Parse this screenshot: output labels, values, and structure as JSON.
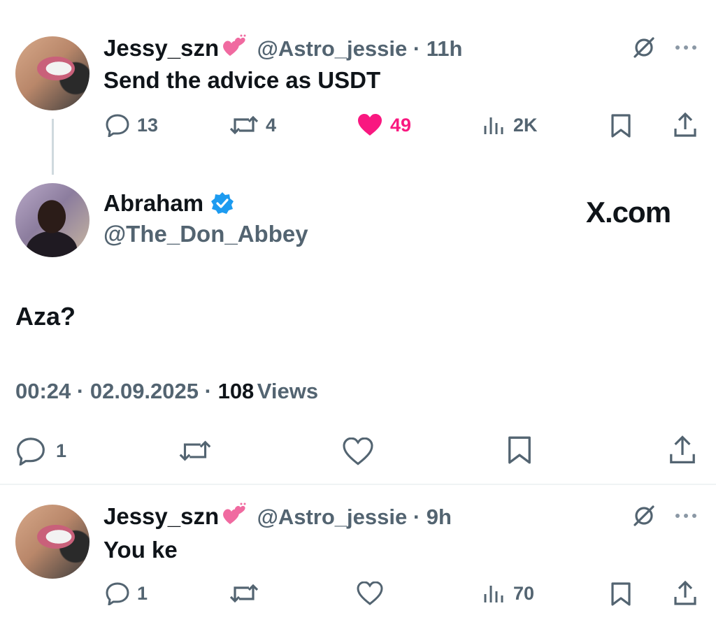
{
  "tweet1": {
    "name": "Jessy_szn",
    "handle": "@Astro_jessie",
    "time": "11h",
    "text": "Send the advice as USDT",
    "replies": "13",
    "reposts": "4",
    "likes": "49",
    "views": "2K",
    "liked": true
  },
  "main": {
    "name": "Abraham",
    "handle": "@The_Don_Abbey",
    "verified": true,
    "watermark": "X.com",
    "text": "Aza?",
    "time": "00:24",
    "date": "02.09.2025",
    "views_count": "108",
    "views_label": "Views",
    "replies": "1"
  },
  "tweet2": {
    "name": "Jessy_szn",
    "handle": "@Astro_jessie",
    "time": "9h",
    "text": "You ke",
    "replies": "1",
    "views": "70"
  },
  "colors": {
    "text": "#0f1419",
    "muted": "#536471",
    "like": "#f91880",
    "verified": "#1d9bf0",
    "divider": "#eff3f4"
  },
  "icons": [
    "reply-icon",
    "repost-icon",
    "like-icon",
    "views-icon",
    "bookmark-icon",
    "share-icon",
    "grok-icon",
    "more-icon",
    "verified-icon",
    "heart-emoji"
  ]
}
